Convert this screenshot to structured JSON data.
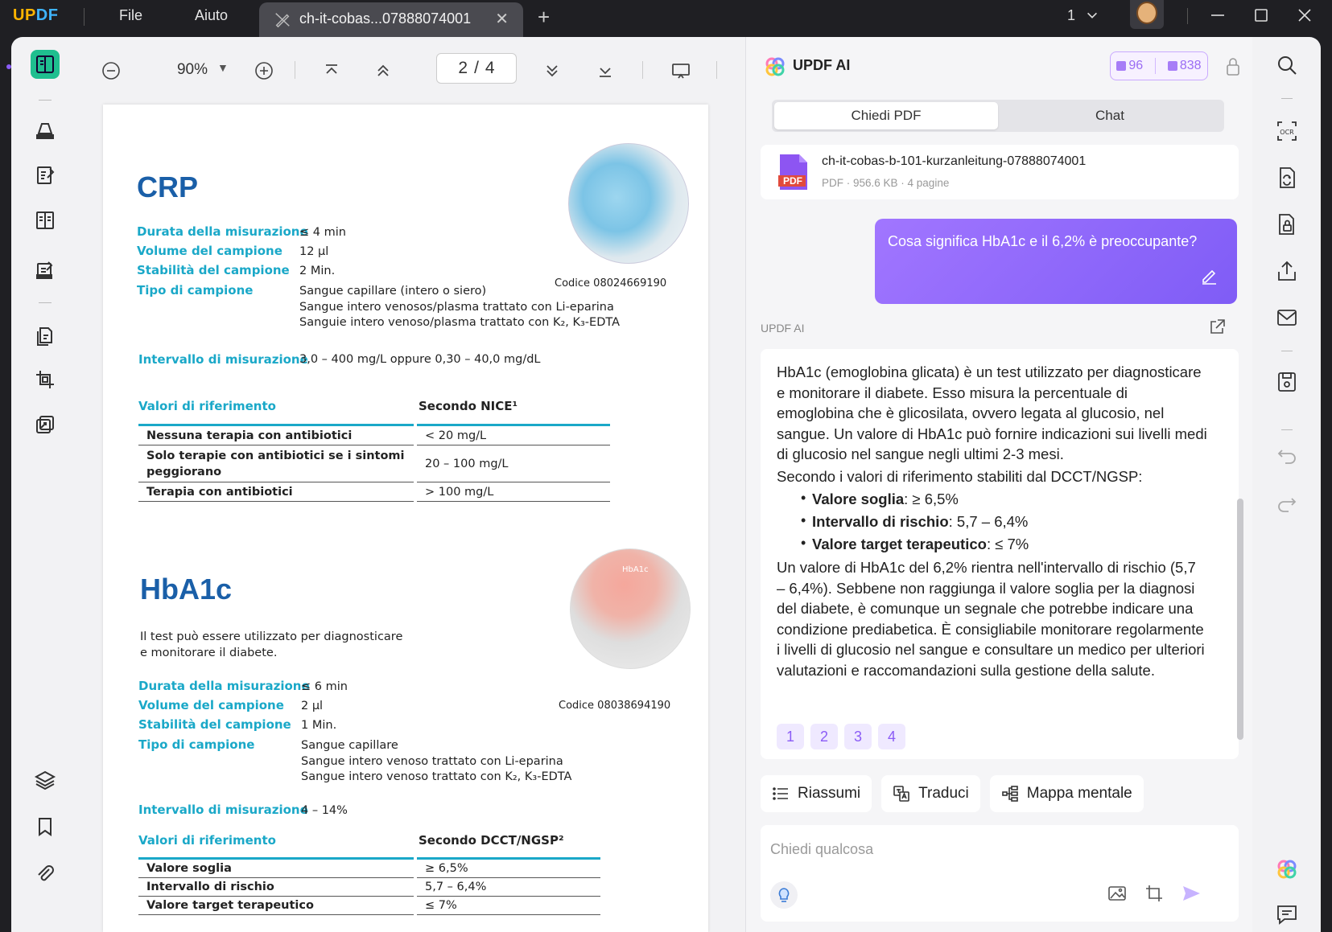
{
  "titlebar": {
    "logo_a": "UP",
    "logo_b": "DF",
    "menu_file": "File",
    "menu_help": "Aiuto",
    "tab_title": "ch-it-cobas...07888074001",
    "tab_close": "✕",
    "new_tab": "+",
    "window_count": "1"
  },
  "toolbar": {
    "zoom": "90%",
    "page_current": "2",
    "page_sep": "/",
    "page_total": "4"
  },
  "document": {
    "crp": {
      "title": "CRP",
      "specs": [
        {
          "label": "Durata della misurazione",
          "value": "≤ 4 min"
        },
        {
          "label": "Volume del campione",
          "value": "12 µl"
        },
        {
          "label": "Stabilità del campione",
          "value": "2 Min."
        },
        {
          "label": "Tipo di campione",
          "value": "Sangue capillare (intero o siero)"
        }
      ],
      "sample_extra_1": "Sangue intero venosos/plasma trattato con Li-eparina",
      "sample_extra_2": "Sanguie intero venoso/plasma trattato con K₂, K₃-EDTA",
      "interval_label": "Intervallo di misurazione",
      "interval_value": "3,0 – 400 mg/L oppure 0,30 – 40,0 mg/dL",
      "ref_label": "Valori di riferimento",
      "ref_source": "Secondo NICE¹",
      "ref_rows": [
        {
          "label": "Nessuna terapia con antibiotici",
          "value": "< 20 mg/L"
        },
        {
          "label": "Solo terapie con antibiotici se i sintomi peggiorano",
          "value": "20 – 100 mg/L"
        },
        {
          "label": "Terapia con antibiotici",
          "value": "> 100 mg/L"
        }
      ],
      "code": "Codice 08024669190"
    },
    "hba1c": {
      "title": "HbA1c",
      "desc": "Il test può essere utilizzato per diagnosticare e monitorare il diabete.",
      "specs": [
        {
          "label": "Durata della misurazione",
          "value": "≤ 6 min"
        },
        {
          "label": "Volume del campione",
          "value": "2 µl"
        },
        {
          "label": "Stabilità del campione",
          "value": "1 Min."
        },
        {
          "label": "Tipo di campione",
          "value": "Sangue capillare"
        }
      ],
      "sample_extra_1": "Sangue intero venoso trattato con Li-eparina",
      "sample_extra_2": "Sangue intero venoso trattato con K₂, K₃-EDTA",
      "interval_label": "Intervallo di misurazione",
      "interval_value": "4 – 14%",
      "ref_label": "Valori di riferimento",
      "ref_source": "Secondo DCCT/NGSP²",
      "ref_rows": [
        {
          "label": "Valore soglia",
          "value": "≥ 6,5%"
        },
        {
          "label": "Intervallo di rischio",
          "value": "5,7 – 6,4%"
        },
        {
          "label": "Valore target terapeutico",
          "value": "≤ 7%"
        }
      ],
      "code": "Codice 08038694190",
      "cassette_label": "HbA1c"
    }
  },
  "ai": {
    "title": "UPDF AI",
    "quota_a": "96",
    "quota_b": "838",
    "tab_ask": "Chiedi PDF",
    "tab_chat": "Chat",
    "file_name": "ch-it-cobas-b-101-kurzanleitung-07888074001",
    "file_meta": "PDF · 956.6 KB · 4 pagine",
    "pdf_badge": "PDF",
    "user_message": "Cosa significa HbA1c e il 6,2% è preoccupante?",
    "answer_label": "UPDF AI",
    "answer_p1": "HbA1c (emoglobina glicata) è un test utilizzato per diagnosticare e monitorare il diabete. Esso misura la percentuale di emoglobina che è glicosilata, ovvero legata al glucosio, nel sangue. Un valore di HbA1c può fornire indicazioni sui livelli medi di glucosio nel sangue negli ultimi 2-3 mesi.",
    "answer_p2": "Secondo i valori di riferimento stabiliti dal DCCT/NGSP:",
    "bullets": [
      {
        "term": "Valore soglia",
        "value": ": ≥ 6,5%"
      },
      {
        "term": "Intervallo di rischio",
        "value": ": 5,7 – 6,4%"
      },
      {
        "term": "Valore target terapeutico",
        "value": ": ≤ 7%"
      }
    ],
    "answer_p3": "Un valore di HbA1c del 6,2% rientra nell'intervallo di rischio (5,7 – 6,4%). Sebbene non raggiunga il valore soglia per la diagnosi del diabete, è comunque un segnale che potrebbe indicare una condizione prediabetica. È consigliabile monitorare regolarmente i livelli di glucosio nel sangue e consultare un medico per ulteriori valutazioni e raccomandazioni sulla gestione della salute.",
    "page_refs": [
      "1",
      "2",
      "3",
      "4"
    ],
    "actions": {
      "summarize": "Riassumi",
      "translate": "Traduci",
      "mindmap": "Mappa mentale"
    },
    "input_placeholder": "Chiedi qualcosa"
  },
  "colors": {
    "accent_purple": "#8b5cf6",
    "doc_cyan": "#1aa8c8",
    "doc_blue": "#1a5fa8",
    "active_tool": "#1fbf8f"
  }
}
